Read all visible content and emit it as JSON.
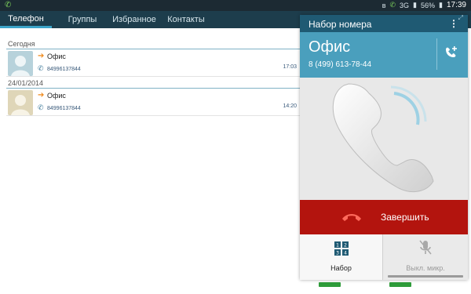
{
  "status_bar": {
    "call_icon": "phone-in-call-icon",
    "icons": [
      "bluetooth-icon",
      "call-indicator-icon",
      "3g-icon",
      "signal-icon"
    ],
    "network_label": "3G",
    "battery_text": "56%",
    "time": "17:39"
  },
  "tabs": [
    {
      "label": "Телефон",
      "active": true
    },
    {
      "label": "Группы",
      "active": false
    },
    {
      "label": "Избранное",
      "active": false
    },
    {
      "label": "Контакты",
      "active": false
    }
  ],
  "call_log": {
    "sections": [
      {
        "header": "Сегодня",
        "entries": [
          {
            "name": "Офис",
            "number": "84996137844",
            "time": "17:03",
            "direction": "outgoing",
            "avatar_color": "#b7d2db"
          }
        ]
      },
      {
        "header": "24/01/2014",
        "entries": [
          {
            "name": "Офис",
            "number": "84996137844",
            "time": "14:20",
            "direction": "outgoing",
            "avatar_color": "#dfd6b8"
          }
        ]
      }
    ]
  },
  "call_popup": {
    "title": "Набор номера",
    "menu_icon": "overflow-menu-icon",
    "contact_name": "Офис",
    "contact_number": "8 (499) 613-78-44",
    "end_call_label": "Завершить",
    "keypad_label": "Набор",
    "mute_label": "Выкл. микр.",
    "colors": {
      "title_bar": "#1f5a73",
      "contact_bar": "#4a9fbd",
      "end_call": "#b3140e"
    }
  }
}
